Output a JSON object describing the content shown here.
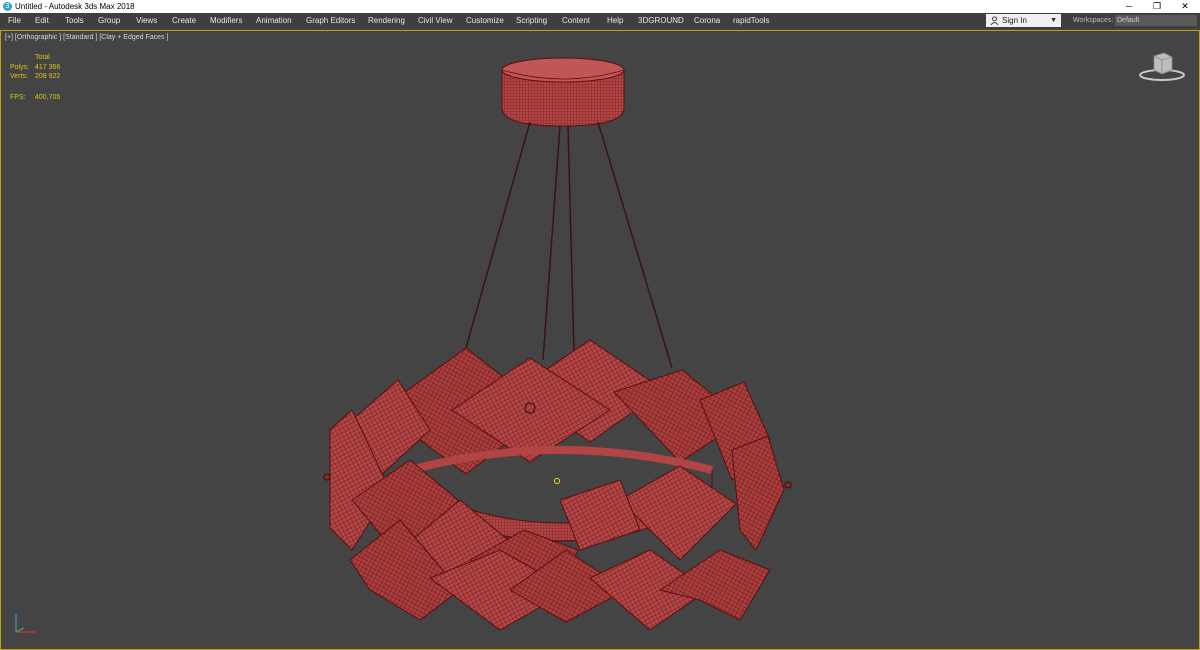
{
  "app": {
    "title": "Untitled - Autodesk 3ds Max 2018"
  },
  "window_controls": {
    "minimize": "─",
    "maximize": "❐",
    "close": "✕"
  },
  "menu": [
    "File",
    "Edit",
    "Tools",
    "Group",
    "Views",
    "Create",
    "Modifiers",
    "Animation",
    "Graph Editors",
    "Rendering",
    "Civil View",
    "Customize",
    "Scripting",
    "Content",
    "Help",
    "3DGROUND",
    "Corona",
    "rapidTools"
  ],
  "signin": {
    "label": "Sign In",
    "arrow": "▼"
  },
  "workspaces": {
    "label": "Workspaces:",
    "value": "Default"
  },
  "viewport": {
    "label": "[+] [Orthographic ] [Standard ] [Clay + Edged Faces ]"
  },
  "stats": {
    "header": "Total",
    "polys_label": "Polys:",
    "polys_value": "417 366",
    "verts_label": "Verts:",
    "verts_value": "208 922",
    "fps_label": "FPS:",
    "fps_value": "400,705"
  },
  "colors": {
    "wire": "#7a1a1a",
    "fill": "#b24444",
    "fill_light": "#c86060",
    "accent": "#b9a400"
  },
  "icons": {
    "viewcube": "viewcube-icon",
    "axis": "axis-gizmo-icon",
    "user": "user-icon"
  }
}
